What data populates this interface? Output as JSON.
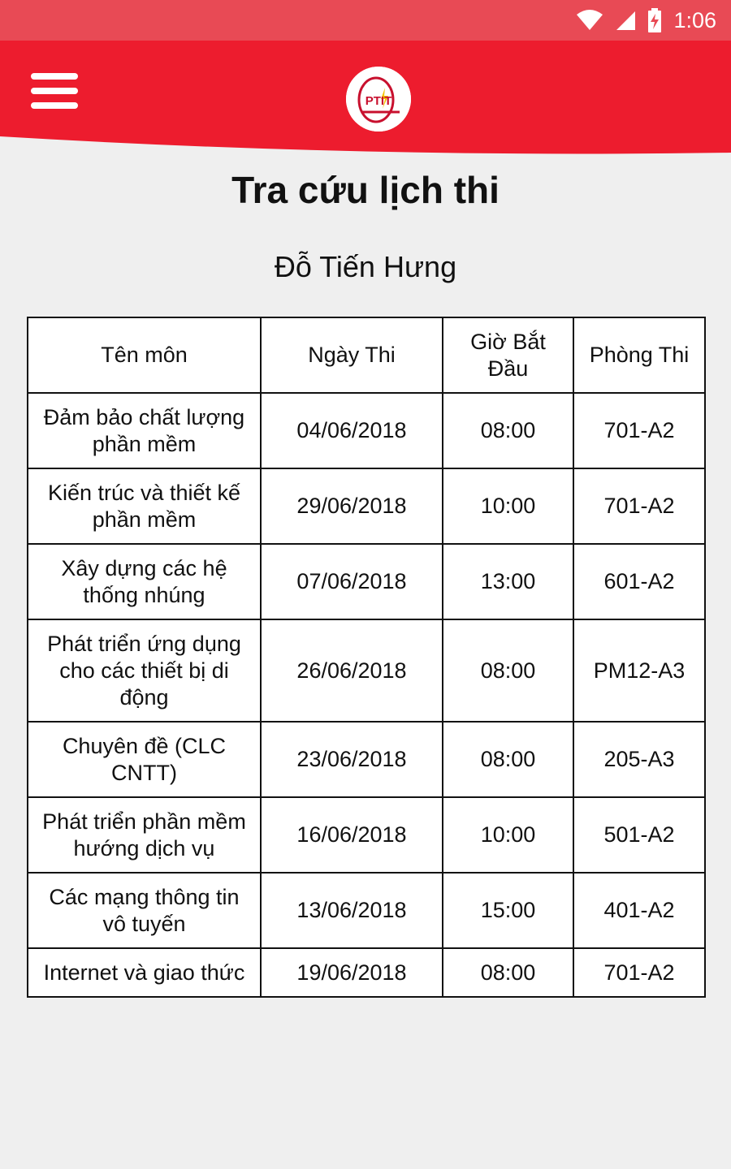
{
  "status_bar": {
    "time": "1:06",
    "icons": [
      "wifi-icon",
      "signal-icon",
      "battery-charging-icon"
    ]
  },
  "header": {
    "menu_icon": "hamburger-menu-icon",
    "logo_text": "PTIT",
    "colors": {
      "primary": "#ed1c2e",
      "status_bar": "#e84a55",
      "background": "#efefef"
    }
  },
  "page": {
    "title": "Tra cứu lịch thi",
    "student_name": "Đỗ Tiến Hưng"
  },
  "table": {
    "columns": [
      "Tên môn",
      "Ngày Thi",
      "Giờ Bắt Đầu",
      "Phòng Thi"
    ],
    "rows": [
      {
        "subject": "Đảm bảo chất lượng phần mềm",
        "date": "04/06/2018",
        "time": "08:00",
        "room": "701-A2"
      },
      {
        "subject": "Kiến trúc và thiết kế phần mềm",
        "date": "29/06/2018",
        "time": "10:00",
        "room": "701-A2"
      },
      {
        "subject": "Xây dựng các hệ thống nhúng",
        "date": "07/06/2018",
        "time": "13:00",
        "room": "601-A2"
      },
      {
        "subject": "Phát triển ứng dụng cho các thiết bị di động",
        "date": "26/06/2018",
        "time": "08:00",
        "room": "PM12-A3"
      },
      {
        "subject": "Chuyên đề (CLC CNTT)",
        "date": "23/06/2018",
        "time": "08:00",
        "room": "205-A3"
      },
      {
        "subject": "Phát triển phần mềm hướng dịch vụ",
        "date": "16/06/2018",
        "time": "10:00",
        "room": "501-A2"
      },
      {
        "subject": "Các mạng thông tin vô tuyến",
        "date": "13/06/2018",
        "time": "15:00",
        "room": "401-A2"
      },
      {
        "subject": "Internet và giao thức",
        "date": "19/06/2018",
        "time": "08:00",
        "room": "701-A2"
      }
    ]
  }
}
